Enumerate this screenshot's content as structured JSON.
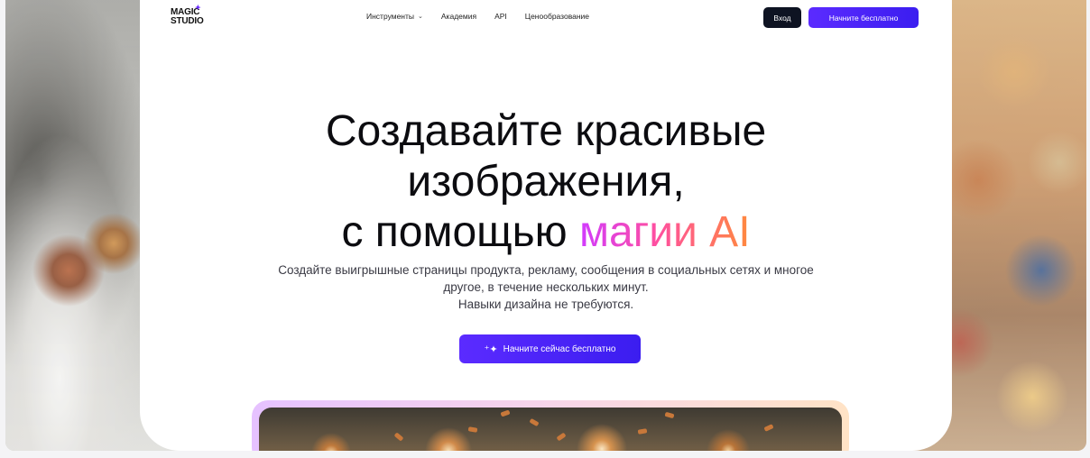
{
  "nav": {
    "logo_line1": "MAGIC",
    "logo_line2": "STUDIO",
    "menu": [
      {
        "label": "Инструменты",
        "has_dropdown": true
      },
      {
        "label": "Академия"
      },
      {
        "label": "API"
      },
      {
        "label": "Ценообразование"
      }
    ],
    "login_label": "Вход",
    "start_label": "Начните бесплатно"
  },
  "hero": {
    "title_line1": "Создавайте красивые",
    "title_line2": "изображения,",
    "title_line3_plain": "с помощью",
    "title_line3_accent": "магии AI",
    "subtitle_line1": "Создайте выигрышные страницы продукта, рекламу, сообщения в социальных сетях и многое",
    "subtitle_line2": "другое, в течение нескольких минут.",
    "subtitle_line3": "Навыки дизайна не требуются.",
    "cta_label": "Начните сейчас бесплатно",
    "cta_icon": "sparkle-icon"
  },
  "colors": {
    "primary": "#4a24f5",
    "dark": "#0e1322",
    "accent_gradient": [
      "#d13bff",
      "#ff4fa0",
      "#ff8a3d"
    ]
  }
}
